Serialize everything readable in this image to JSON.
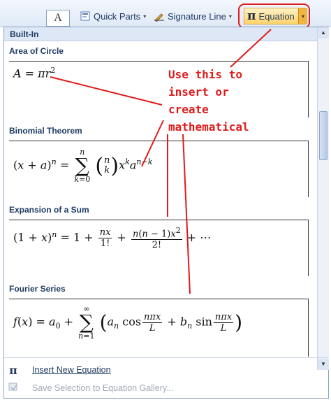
{
  "ribbon": {
    "textbox_glyph": "A",
    "quick_parts_label": "Quick Parts",
    "signature_line_label": "Signature Line",
    "equation_label": "Equation",
    "equation_glyph": "π",
    "dropdown_arrow": "▾"
  },
  "gallery": {
    "header": "Built-In",
    "sections": [
      {
        "title": "Area of Circle"
      },
      {
        "title": "Binomial Theorem"
      },
      {
        "title": "Expansion of a Sum"
      },
      {
        "title": "Fourier Series"
      }
    ]
  },
  "menu": {
    "insert_new_label": "Insert New Equation",
    "insert_new_glyph": "π",
    "save_selection_label": "Save Selection to Equation Gallery..."
  },
  "annotation": {
    "lines": [
      "Use this to",
      "insert or",
      "create",
      "mathematical"
    ],
    "color": "#e01b1b"
  },
  "colors": {
    "header_text": "#1f3b63",
    "highlight_border": "#e01b1b",
    "equation_button_fill": "#ffd36b"
  }
}
